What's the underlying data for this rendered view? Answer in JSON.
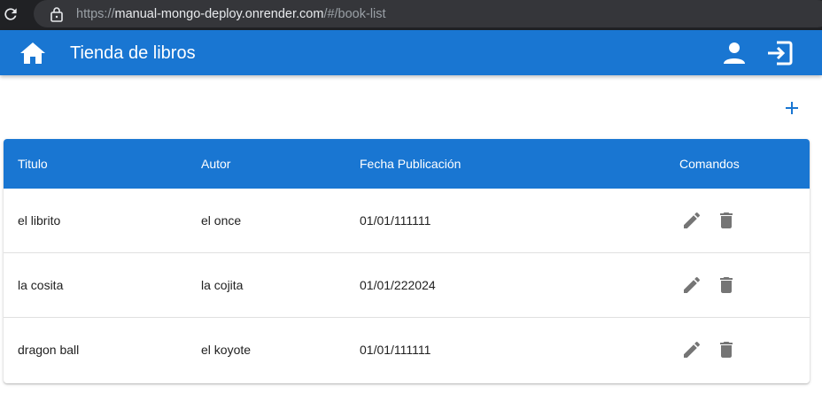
{
  "browser": {
    "url_scheme": "https://",
    "url_host": "manual-mongo-deploy.onrender.com",
    "url_path": "/#/book-list"
  },
  "toolbar": {
    "title": "Tienda de libros",
    "icons": {
      "home": "home-icon",
      "user": "account-icon",
      "logout": "login-exit-icon"
    },
    "color": "#1976d2"
  },
  "actions": {
    "add_icon": "plus-icon",
    "accent": "#1976d2"
  },
  "table": {
    "headers": [
      "Titulo",
      "Autor",
      "Fecha Publicación",
      "Comandos"
    ],
    "rows": [
      {
        "titulo": "el librito",
        "autor": "el once",
        "fecha": "01/01/111111"
      },
      {
        "titulo": "la cosita",
        "autor": "la cojita",
        "fecha": "01/01/222024"
      },
      {
        "titulo": "dragon ball",
        "autor": "el koyote",
        "fecha": "01/01/111111"
      }
    ],
    "row_icons": {
      "edit": "pencil-icon",
      "delete": "trash-icon"
    }
  }
}
